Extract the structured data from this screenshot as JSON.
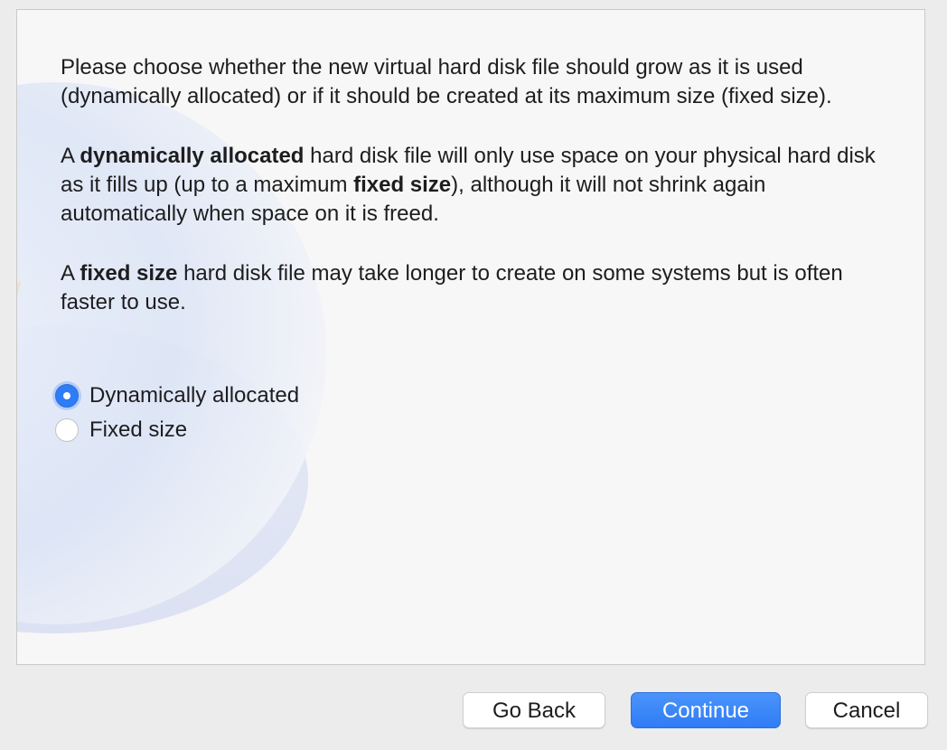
{
  "description": {
    "p1": "Please choose whether the new virtual hard disk file should grow as it is used (dynamically allocated) or if it should be created at its maximum size (fixed size).",
    "p2": {
      "t1": "A ",
      "b1": "dynamically allocated",
      "t2": " hard disk file will only use space on your physical hard disk as it fills up (up to a maximum ",
      "b2": "fixed size",
      "t3": "), although it will not shrink again automatically when space on it is freed."
    },
    "p3": {
      "t1": "A ",
      "b1": "fixed size",
      "t2": " hard disk file may take longer to create on some systems but is often faster to use."
    }
  },
  "options": {
    "dynamic_label": "Dynamically allocated",
    "fixed_label": "Fixed size",
    "selected": "Dynamically allocated"
  },
  "buttons": {
    "back_label": "Go Back",
    "continue_label": "Continue",
    "cancel_label": "Cancel"
  },
  "colors": {
    "accent": "#2f7cf6",
    "panel_bg": "#f7f7f7",
    "window_bg": "#ececec"
  }
}
